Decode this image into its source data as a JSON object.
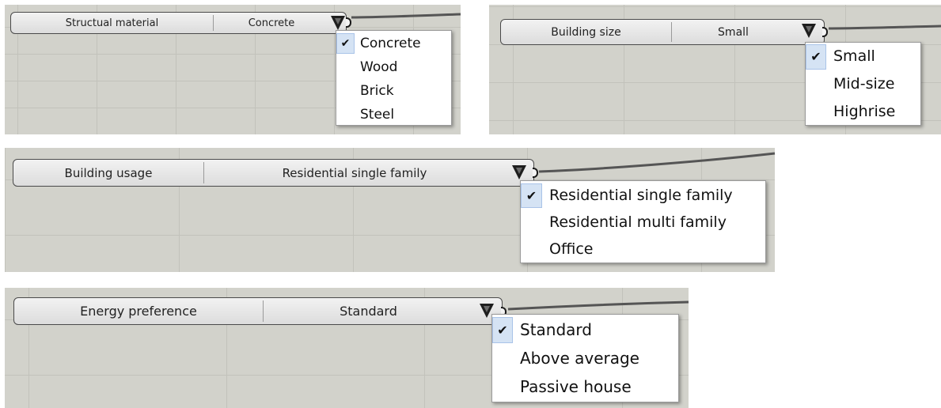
{
  "widgets": [
    {
      "label": "Structual material",
      "value": "Concrete",
      "options": [
        "Concrete",
        "Wood",
        "Brick",
        "Steel"
      ],
      "selected": "Concrete"
    },
    {
      "label": "Building size",
      "value": "Small",
      "options": [
        "Small",
        "Mid-size",
        "Highrise"
      ],
      "selected": "Small"
    },
    {
      "label": "Building usage",
      "value": "Residential single family",
      "options": [
        "Residential single family",
        "Residential multi family",
        "Office"
      ],
      "selected": "Residential single family"
    },
    {
      "label": "Energy preference",
      "value": "Standard",
      "options": [
        "Standard",
        "Above average",
        "Passive house"
      ],
      "selected": "Standard"
    }
  ],
  "icons": {
    "dropdown": "dropdown-arrow-icon",
    "check": "checkmark-icon",
    "output": "output-grip-icon"
  },
  "colors": {
    "canvas": "#d2d2cb",
    "widget_border": "#4a4a4a",
    "check_highlight": "#d5e3f4",
    "wire": "#555555"
  }
}
